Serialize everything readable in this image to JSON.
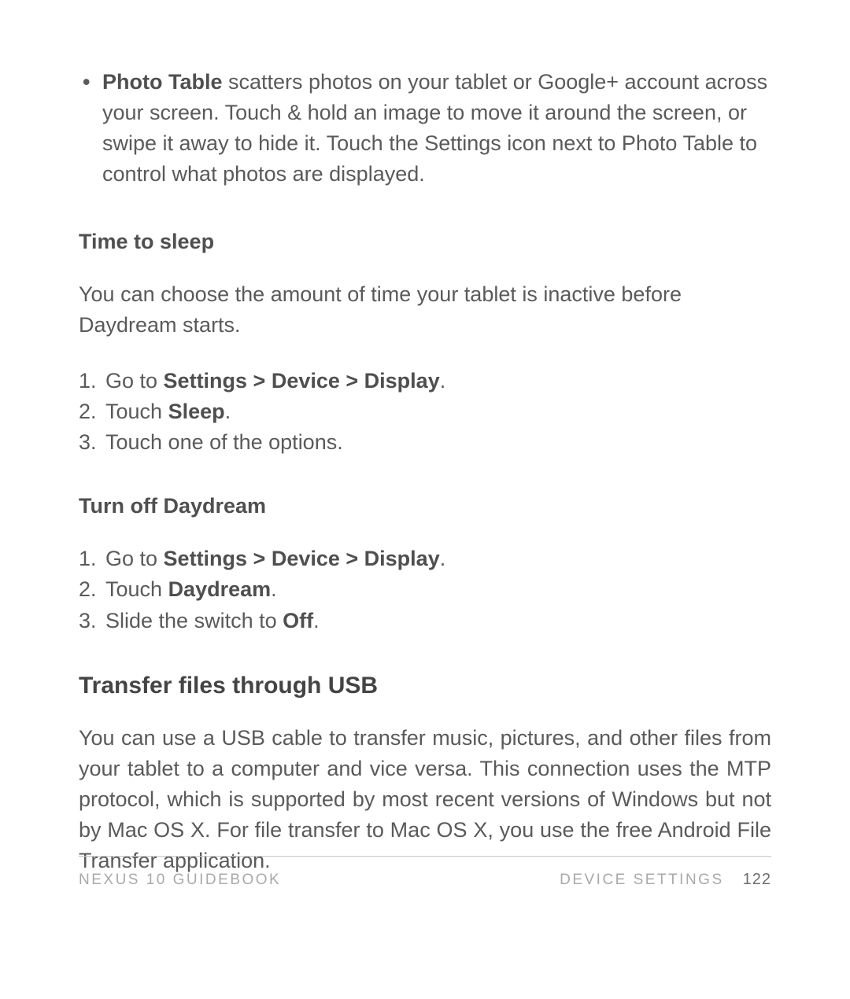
{
  "bullet": {
    "lead_bold": "Photo Table",
    "text": " scatters photos on your tablet or Google+ account across your screen.  Touch & hold an image to move it around the screen, or swipe it away to hide it. Touch the Settings icon next to Photo Table to control what photos are displayed."
  },
  "time_to_sleep": {
    "heading": "Time to sleep",
    "intro": "You can choose the amount of time your tablet is inactive before Daydream starts.",
    "steps": [
      {
        "pre": "Go to ",
        "bold": "Settings > Device > Display",
        "post": "."
      },
      {
        "pre": "Touch ",
        "bold": "Sleep",
        "post": "."
      },
      {
        "pre": "Touch one of the options.",
        "bold": "",
        "post": ""
      }
    ]
  },
  "turn_off": {
    "heading": "Turn off Daydream",
    "steps": [
      {
        "pre": "Go to ",
        "bold": "Settings > Device > Display",
        "post": "."
      },
      {
        "pre": "Touch ",
        "bold": "Daydream",
        "post": "."
      },
      {
        "pre": "Slide the switch to ",
        "bold": "Off",
        "post": "."
      }
    ]
  },
  "transfer": {
    "heading": "Transfer files through USB",
    "body": "You can use a USB cable to transfer music, pictures, and other files from your tablet to a computer and vice versa. This connection uses the MTP protocol, which is supported by most recent versions of Windows but not by Mac OS X. For file transfer to Mac OS X, you use the free Android File Transfer application."
  },
  "footer": {
    "left": "NEXUS 10 GUIDEBOOK",
    "section": "DEVICE SETTINGS",
    "page": "122"
  }
}
